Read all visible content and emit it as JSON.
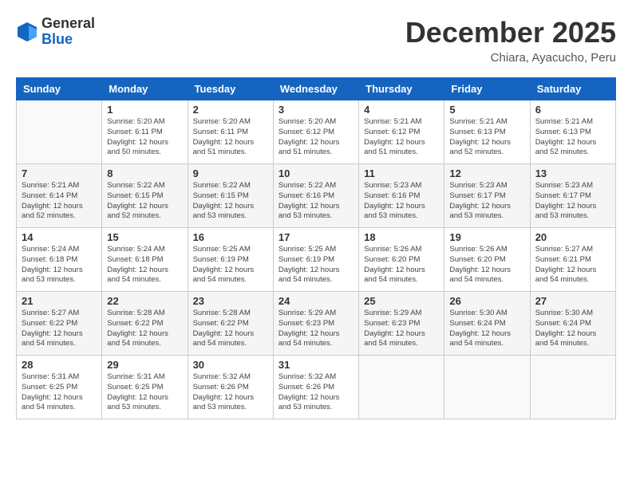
{
  "header": {
    "logo_general": "General",
    "logo_blue": "Blue",
    "month_title": "December 2025",
    "subtitle": "Chiara, Ayacucho, Peru"
  },
  "days_of_week": [
    "Sunday",
    "Monday",
    "Tuesday",
    "Wednesday",
    "Thursday",
    "Friday",
    "Saturday"
  ],
  "weeks": [
    [
      {
        "day": "",
        "info": ""
      },
      {
        "day": "1",
        "info": "Sunrise: 5:20 AM\nSunset: 6:11 PM\nDaylight: 12 hours\nand 50 minutes."
      },
      {
        "day": "2",
        "info": "Sunrise: 5:20 AM\nSunset: 6:11 PM\nDaylight: 12 hours\nand 51 minutes."
      },
      {
        "day": "3",
        "info": "Sunrise: 5:20 AM\nSunset: 6:12 PM\nDaylight: 12 hours\nand 51 minutes."
      },
      {
        "day": "4",
        "info": "Sunrise: 5:21 AM\nSunset: 6:12 PM\nDaylight: 12 hours\nand 51 minutes."
      },
      {
        "day": "5",
        "info": "Sunrise: 5:21 AM\nSunset: 6:13 PM\nDaylight: 12 hours\nand 52 minutes."
      },
      {
        "day": "6",
        "info": "Sunrise: 5:21 AM\nSunset: 6:13 PM\nDaylight: 12 hours\nand 52 minutes."
      }
    ],
    [
      {
        "day": "7",
        "info": "Sunrise: 5:21 AM\nSunset: 6:14 PM\nDaylight: 12 hours\nand 52 minutes."
      },
      {
        "day": "8",
        "info": "Sunrise: 5:22 AM\nSunset: 6:15 PM\nDaylight: 12 hours\nand 52 minutes."
      },
      {
        "day": "9",
        "info": "Sunrise: 5:22 AM\nSunset: 6:15 PM\nDaylight: 12 hours\nand 53 minutes."
      },
      {
        "day": "10",
        "info": "Sunrise: 5:22 AM\nSunset: 6:16 PM\nDaylight: 12 hours\nand 53 minutes."
      },
      {
        "day": "11",
        "info": "Sunrise: 5:23 AM\nSunset: 6:16 PM\nDaylight: 12 hours\nand 53 minutes."
      },
      {
        "day": "12",
        "info": "Sunrise: 5:23 AM\nSunset: 6:17 PM\nDaylight: 12 hours\nand 53 minutes."
      },
      {
        "day": "13",
        "info": "Sunrise: 5:23 AM\nSunset: 6:17 PM\nDaylight: 12 hours\nand 53 minutes."
      }
    ],
    [
      {
        "day": "14",
        "info": "Sunrise: 5:24 AM\nSunset: 6:18 PM\nDaylight: 12 hours\nand 53 minutes."
      },
      {
        "day": "15",
        "info": "Sunrise: 5:24 AM\nSunset: 6:18 PM\nDaylight: 12 hours\nand 54 minutes."
      },
      {
        "day": "16",
        "info": "Sunrise: 5:25 AM\nSunset: 6:19 PM\nDaylight: 12 hours\nand 54 minutes."
      },
      {
        "day": "17",
        "info": "Sunrise: 5:25 AM\nSunset: 6:19 PM\nDaylight: 12 hours\nand 54 minutes."
      },
      {
        "day": "18",
        "info": "Sunrise: 5:26 AM\nSunset: 6:20 PM\nDaylight: 12 hours\nand 54 minutes."
      },
      {
        "day": "19",
        "info": "Sunrise: 5:26 AM\nSunset: 6:20 PM\nDaylight: 12 hours\nand 54 minutes."
      },
      {
        "day": "20",
        "info": "Sunrise: 5:27 AM\nSunset: 6:21 PM\nDaylight: 12 hours\nand 54 minutes."
      }
    ],
    [
      {
        "day": "21",
        "info": "Sunrise: 5:27 AM\nSunset: 6:22 PM\nDaylight: 12 hours\nand 54 minutes."
      },
      {
        "day": "22",
        "info": "Sunrise: 5:28 AM\nSunset: 6:22 PM\nDaylight: 12 hours\nand 54 minutes."
      },
      {
        "day": "23",
        "info": "Sunrise: 5:28 AM\nSunset: 6:22 PM\nDaylight: 12 hours\nand 54 minutes."
      },
      {
        "day": "24",
        "info": "Sunrise: 5:29 AM\nSunset: 6:23 PM\nDaylight: 12 hours\nand 54 minutes."
      },
      {
        "day": "25",
        "info": "Sunrise: 5:29 AM\nSunset: 6:23 PM\nDaylight: 12 hours\nand 54 minutes."
      },
      {
        "day": "26",
        "info": "Sunrise: 5:30 AM\nSunset: 6:24 PM\nDaylight: 12 hours\nand 54 minutes."
      },
      {
        "day": "27",
        "info": "Sunrise: 5:30 AM\nSunset: 6:24 PM\nDaylight: 12 hours\nand 54 minutes."
      }
    ],
    [
      {
        "day": "28",
        "info": "Sunrise: 5:31 AM\nSunset: 6:25 PM\nDaylight: 12 hours\nand 54 minutes."
      },
      {
        "day": "29",
        "info": "Sunrise: 5:31 AM\nSunset: 6:25 PM\nDaylight: 12 hours\nand 53 minutes."
      },
      {
        "day": "30",
        "info": "Sunrise: 5:32 AM\nSunset: 6:26 PM\nDaylight: 12 hours\nand 53 minutes."
      },
      {
        "day": "31",
        "info": "Sunrise: 5:32 AM\nSunset: 6:26 PM\nDaylight: 12 hours\nand 53 minutes."
      },
      {
        "day": "",
        "info": ""
      },
      {
        "day": "",
        "info": ""
      },
      {
        "day": "",
        "info": ""
      }
    ]
  ]
}
